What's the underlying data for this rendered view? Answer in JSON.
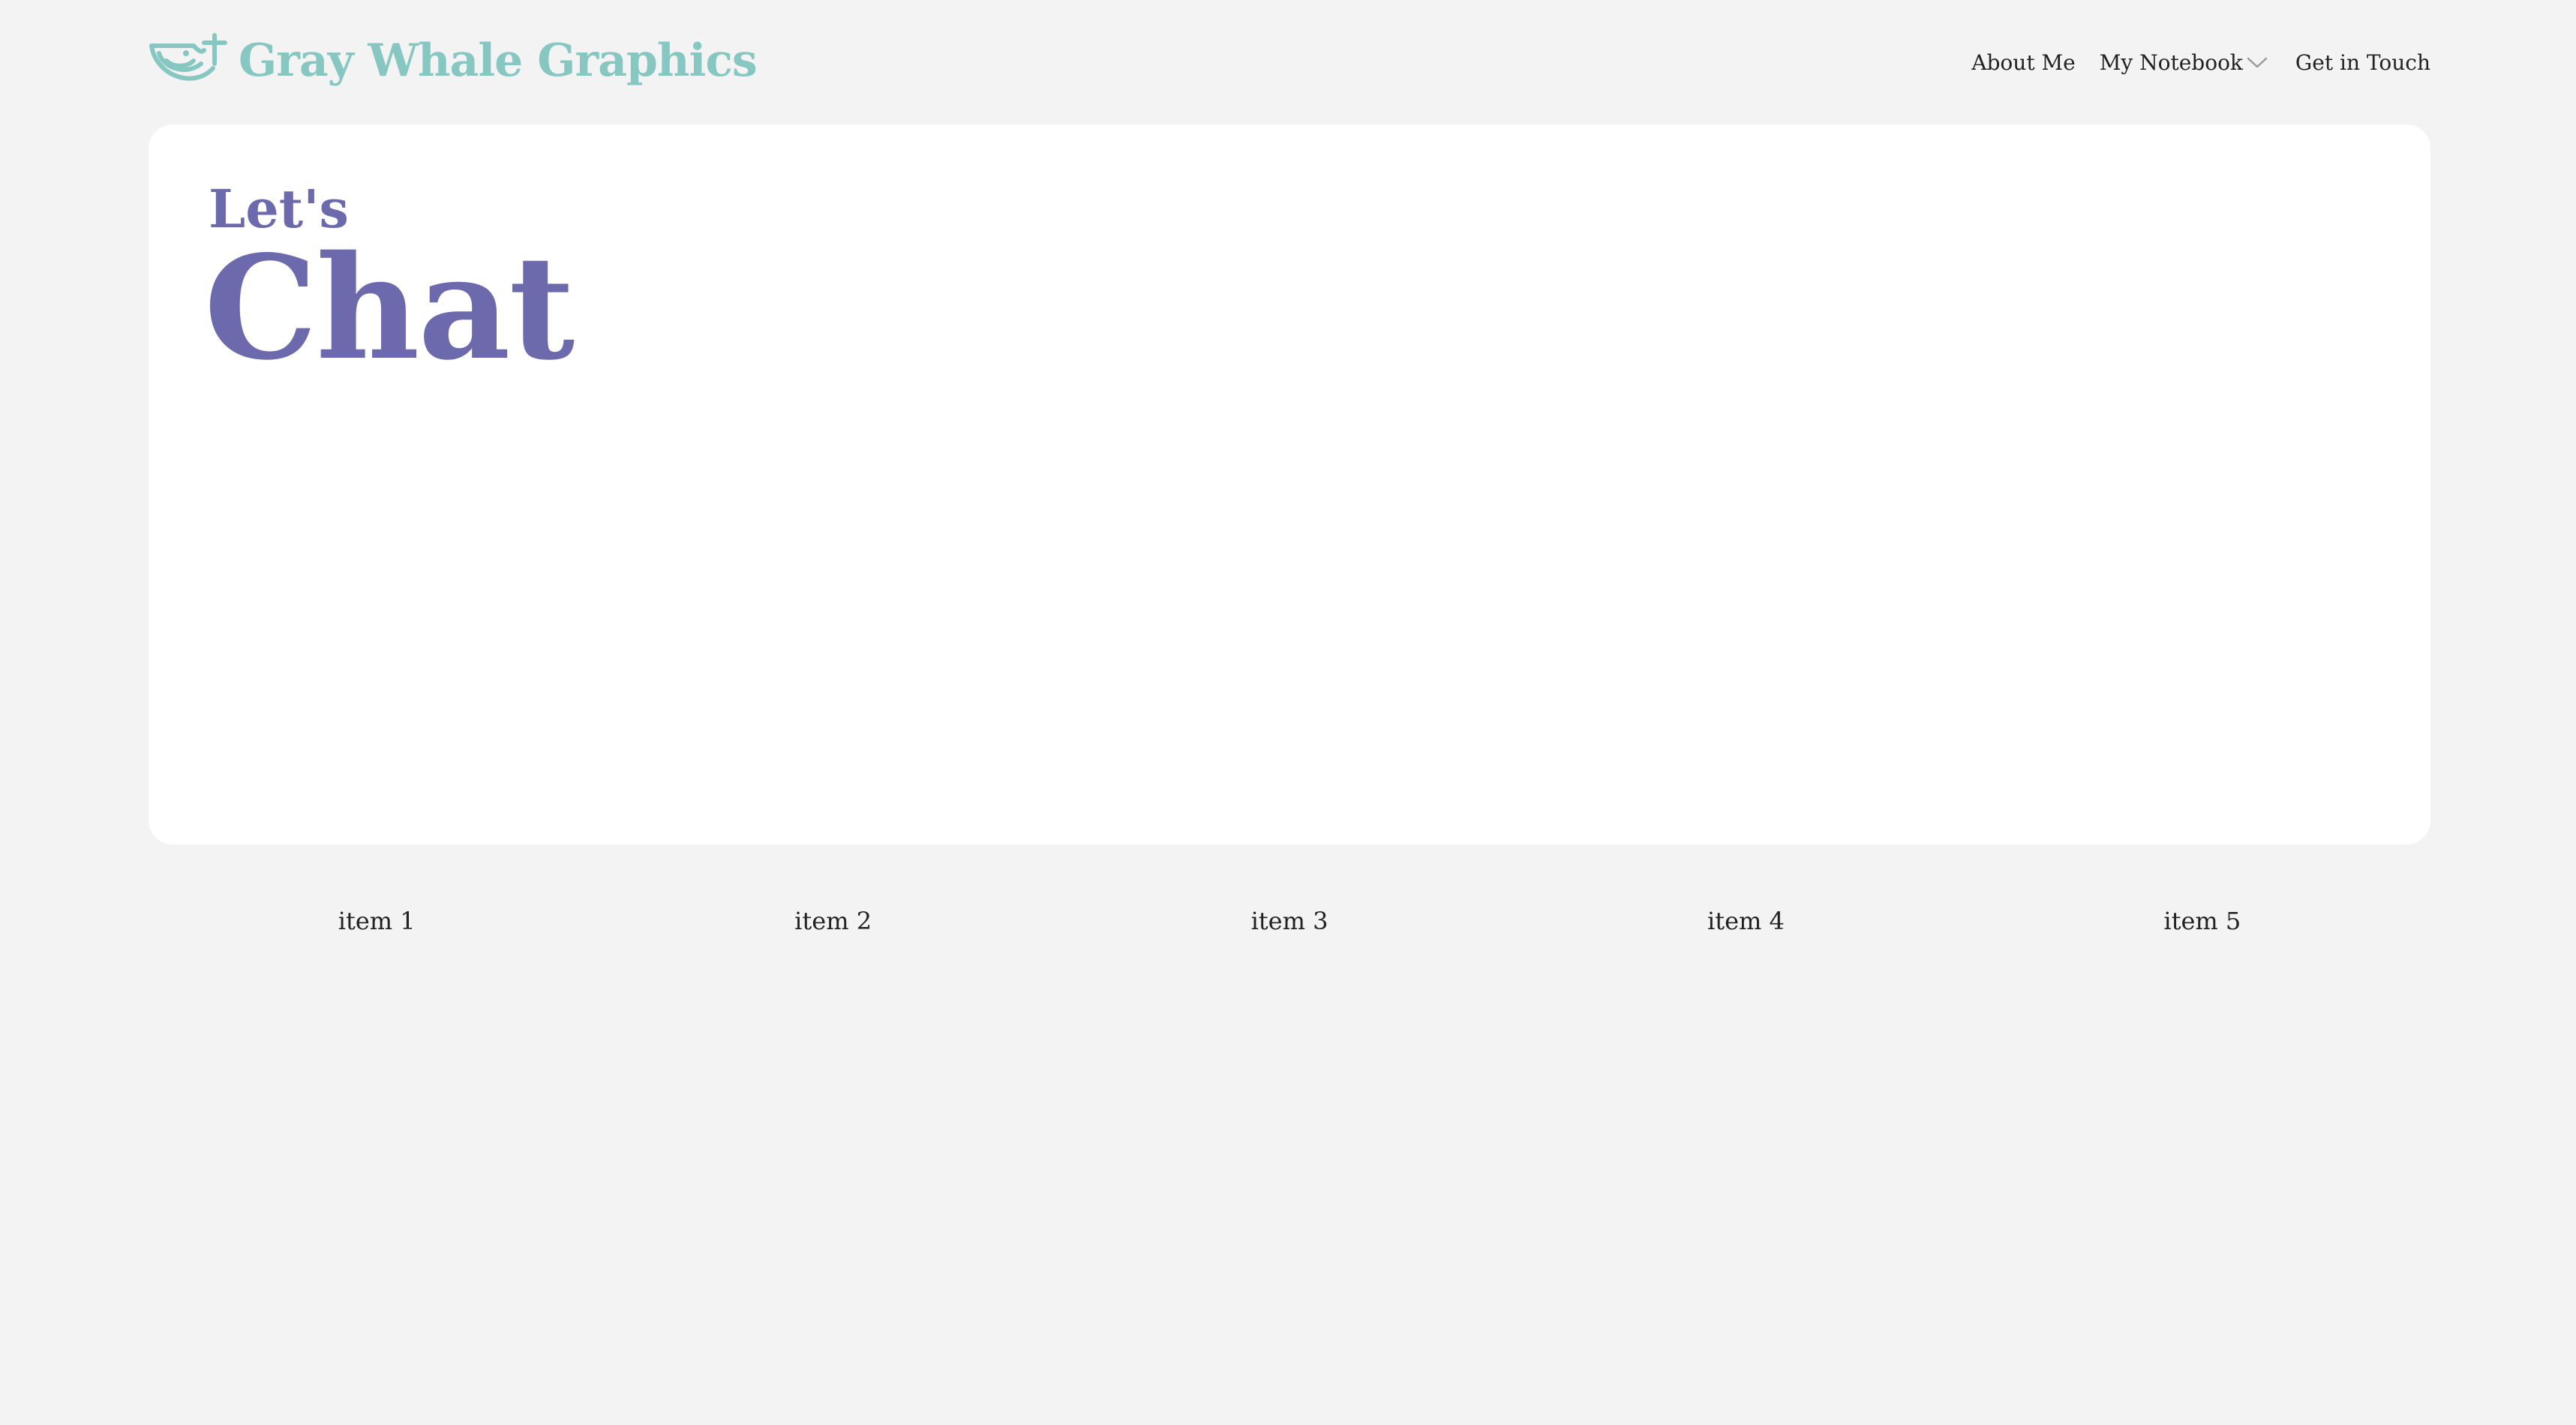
{
  "brand": {
    "name": "Gray Whale Graphics",
    "logo_icon": "whale-tail-icon",
    "color": "#87c7c2"
  },
  "nav": {
    "items": [
      {
        "label": "About Me"
      },
      {
        "label": "My Notebook",
        "icon": "chevron-down-icon"
      },
      {
        "label": "Get in Touch"
      }
    ]
  },
  "hero": {
    "kicker": "Let's",
    "title": "Chat",
    "color": "#6c6aac"
  },
  "items": [
    {
      "label": "item 1"
    },
    {
      "label": "item 2"
    },
    {
      "label": "item 3"
    },
    {
      "label": "item 4"
    },
    {
      "label": "item 5"
    }
  ],
  "colors": {
    "background": "#f3f3f3",
    "card": "#ffffff",
    "text": "#222222"
  }
}
